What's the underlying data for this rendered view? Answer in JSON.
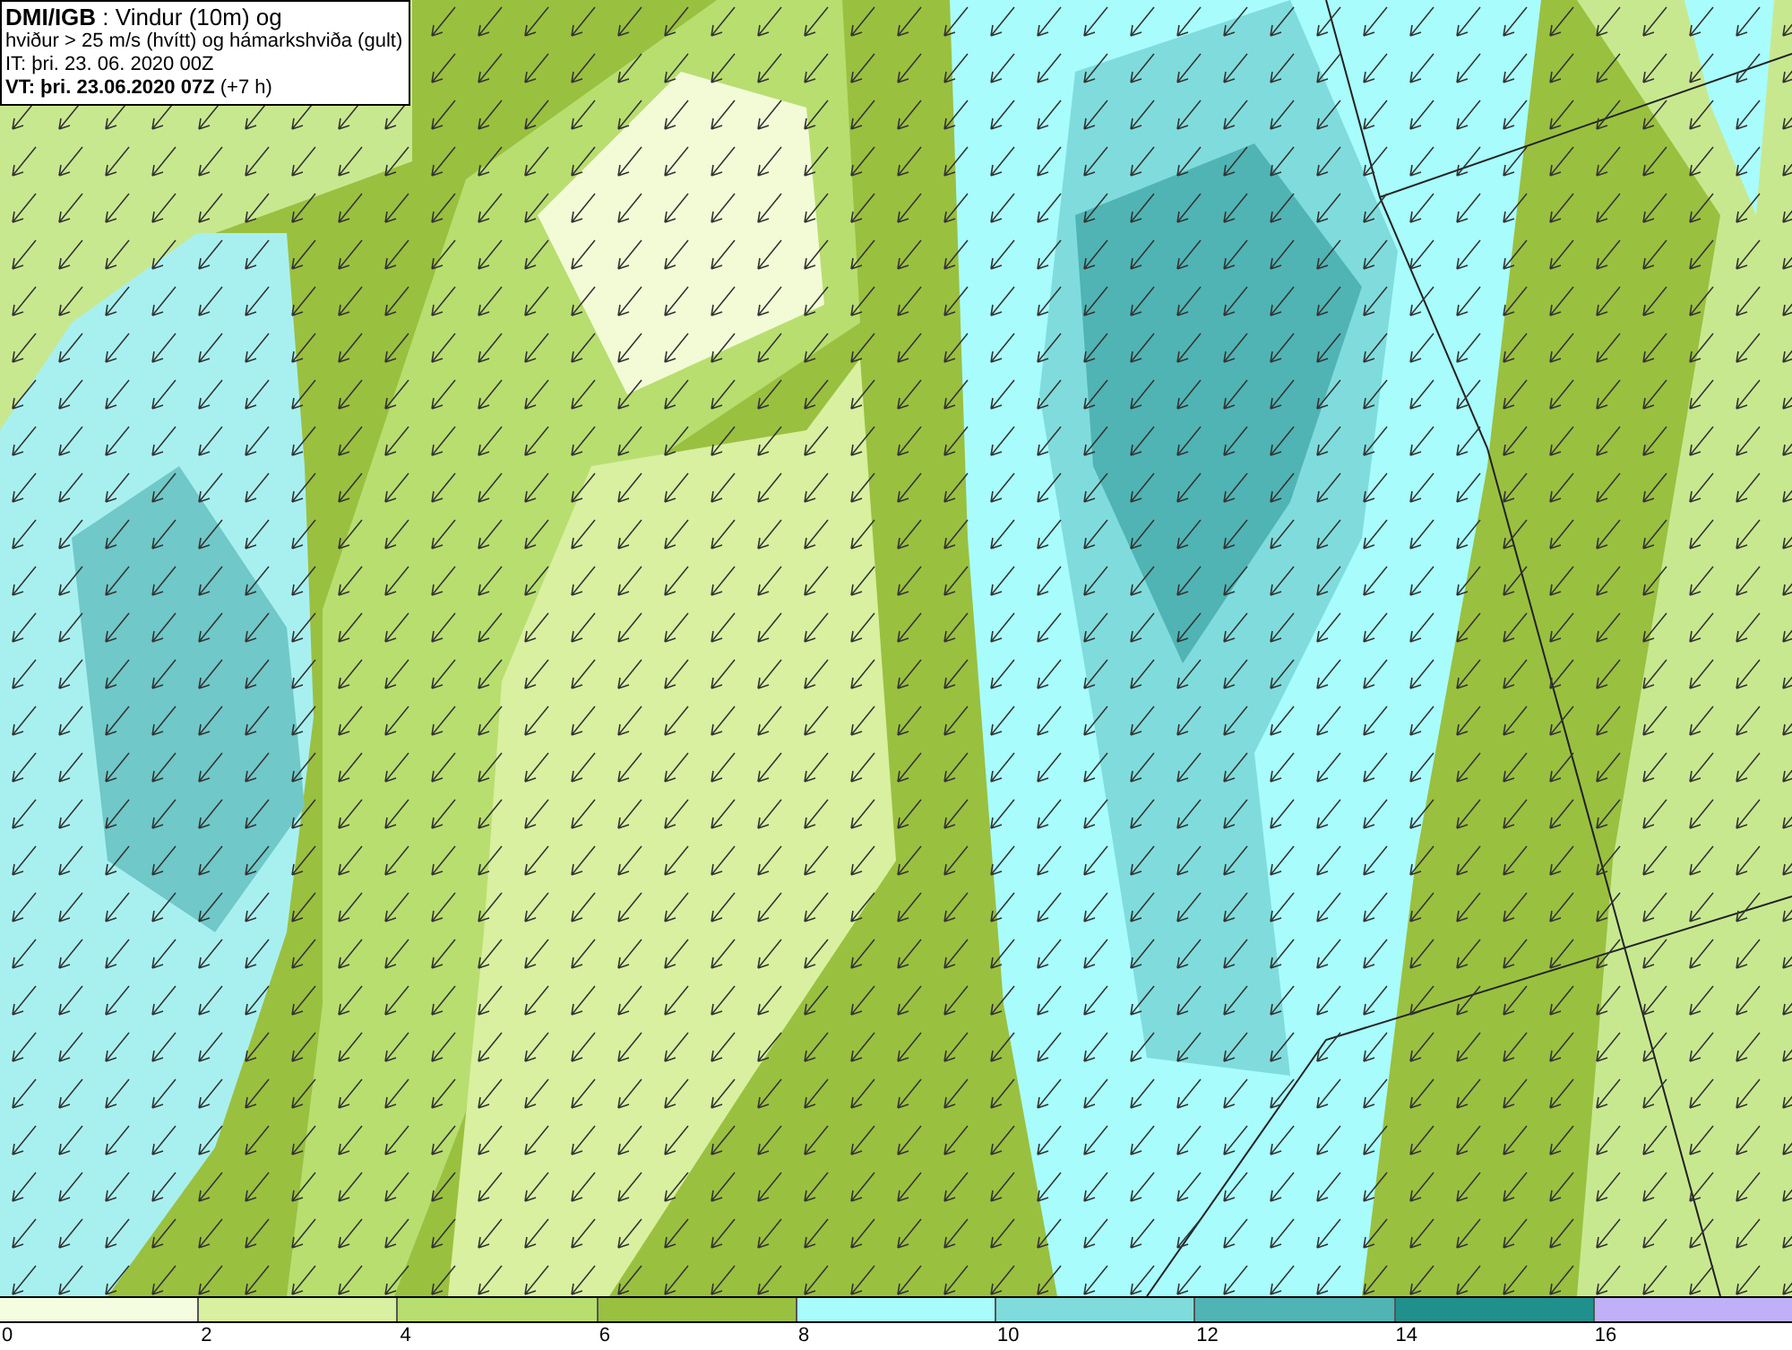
{
  "title_box": {
    "lines": [
      "**DMI/IGB** : Vindur (10m) og",
      "hviður > 25 m/s (hvítt) og hámarkshviða (gult)",
      "IT: þri. 23. 06. 2020 00Z",
      "**VT: þri. 23.06.2020 07Z** (+7 h)"
    ]
  },
  "legend": {
    "swatches": [
      {
        "color": "#f5fde0"
      },
      {
        "color": "#d8f0a0"
      },
      {
        "color": "#b8de70"
      },
      {
        "color": "#9ac040"
      },
      {
        "color": "#a8fcfc"
      },
      {
        "color": "#80dcdc"
      },
      {
        "color": "#50b4b4"
      },
      {
        "color": "#20908c"
      },
      {
        "color": "#c0b0f8"
      }
    ],
    "labels": [
      "0",
      "2",
      "4",
      "6",
      "8",
      "10",
      "12",
      "14",
      "16"
    ]
  }
}
